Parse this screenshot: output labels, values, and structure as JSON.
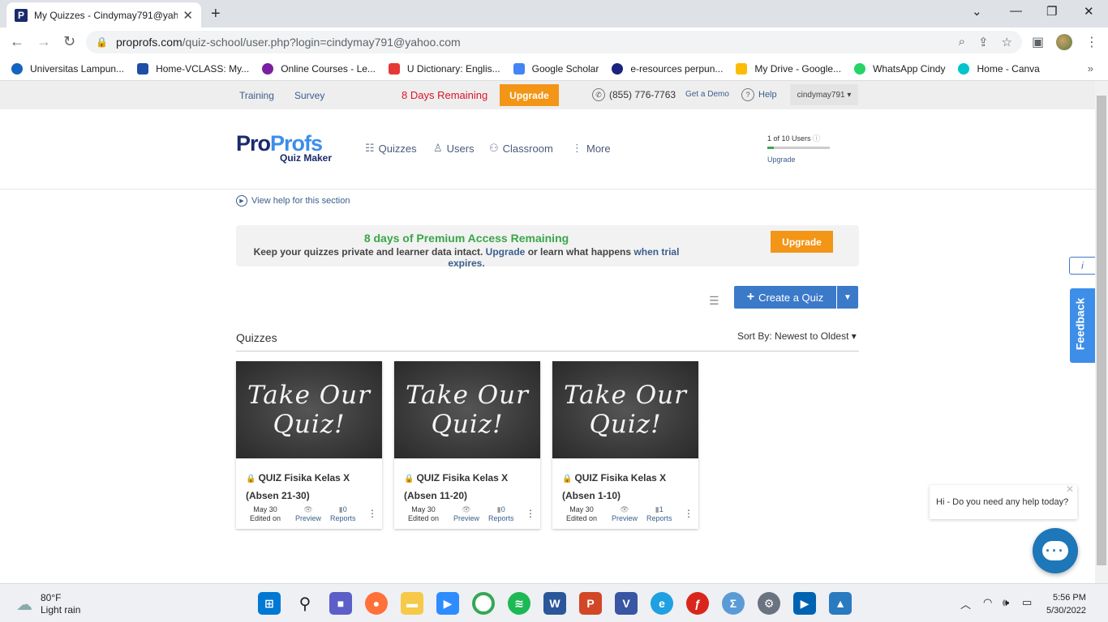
{
  "browser": {
    "tab_title": "My Quizzes - Cindymay791@yah",
    "tab_favicon": "P",
    "url_host": "proprofs.com",
    "url_path": "/quiz-school/user.php?login=cindymay791@yahoo.com"
  },
  "bookmarks": [
    {
      "label": "Universitas Lampun...",
      "color": "#1565c0"
    },
    {
      "label": "Home-VCLASS: My...",
      "color": "#1e4fa8"
    },
    {
      "label": "Online Courses - Le...",
      "color": "#7b1fa2"
    },
    {
      "label": "U Dictionary: Englis...",
      "color": "#e53935"
    },
    {
      "label": "Google Scholar",
      "color": "#4285f4"
    },
    {
      "label": "e-resources perpun...",
      "color": "#1a237e"
    },
    {
      "label": "My Drive - Google...",
      "color": "#fbbc04"
    },
    {
      "label": "WhatsApp Cindy",
      "color": "#25d366"
    },
    {
      "label": "Home - Canva",
      "color": "#00c4cc"
    }
  ],
  "topbar": {
    "training": "Training",
    "survey": "Survey",
    "days_remaining": "8 Days Remaining",
    "upgrade": "Upgrade",
    "phone": "(855) 776-7763",
    "demo": "Get a Demo",
    "help": "Help",
    "username": "cindymay791 ▾"
  },
  "header": {
    "logo_pro": "Pro",
    "logo_profs": "Profs",
    "logo_sub": "Quiz Maker",
    "nav_quizzes": "Quizzes",
    "nav_users": "Users",
    "nav_classroom": "Classroom",
    "nav_more": "More",
    "user_count": "1  of  10 Users",
    "user_upgrade": "Upgrade"
  },
  "main": {
    "view_help": "View help for this section",
    "banner_title": "8 days of Premium Access Remaining",
    "banner_text_a": "Keep your quizzes private and learner data intact.",
    "banner_link1": "Upgrade",
    "banner_text_b": "or learn what happens",
    "banner_link2": "when trial expires.",
    "banner_upgrade": "Upgrade",
    "create_quiz": "Create a Quiz",
    "quizzes_title": "Quizzes",
    "sort_label": "Sort By:",
    "sort_value": "Newest to Oldest ▾"
  },
  "quizzes": [
    {
      "thumb_line1": "Take Our",
      "thumb_line2": "Quiz!",
      "title": "QUIZ Fisika Kelas X (Absen 21-30)",
      "date": "May 30",
      "edited": "Edited on",
      "preview": "Preview",
      "count": "0",
      "reports": "Reports"
    },
    {
      "thumb_line1": "Take Our",
      "thumb_line2": "Quiz!",
      "title": "QUIZ Fisika Kelas X (Absen 11-20)",
      "date": "May 30",
      "edited": "Edited on",
      "preview": "Preview",
      "count": "0",
      "reports": "Reports"
    },
    {
      "thumb_line1": "Take Our",
      "thumb_line2": "Quiz!",
      "title": "QUIZ Fisika Kelas X (Absen 1-10)",
      "date": "May 30",
      "edited": "Edited on",
      "preview": "Preview",
      "count": "1",
      "reports": "Reports"
    }
  ],
  "side": {
    "info": "i",
    "feedback": "Feedback",
    "chat_message": "Hi - Do you need any help today?"
  },
  "taskbar": {
    "temp": "80°F",
    "weather": "Light rain",
    "time": "5:56 PM",
    "date": "5/30/2022"
  }
}
